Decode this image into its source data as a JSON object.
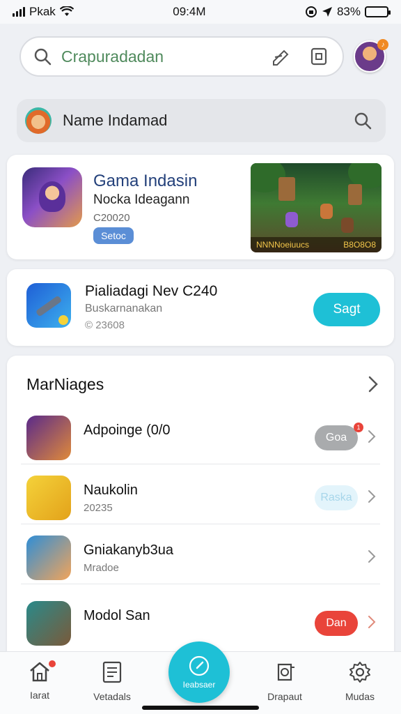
{
  "status_bar": {
    "carrier": "Pkak",
    "time": "09:4M",
    "battery": "83%",
    "battery_level": 0.83
  },
  "search": {
    "placeholder": "Crapuradadan"
  },
  "name_search": {
    "text": "Name Indamad"
  },
  "featured": {
    "title": "Gama Indasin",
    "subtitle": "Nocka Ideagann",
    "meta": "C20020",
    "badge": "Setoc",
    "hud_left": "NNNNoeiuucs",
    "hud_right": "B8O8O8"
  },
  "promo": {
    "title": "Pialiadagi Nev C240",
    "subtitle": "Buskarnanakan",
    "meta": "© 23608",
    "button": "Sagt"
  },
  "list": {
    "heading": "MarNiages",
    "rows": [
      {
        "title": "Adpoinge (0/0",
        "subtitle": "",
        "button": "Goa",
        "button_style": "gray",
        "has_badge": true,
        "badge_text": "1"
      },
      {
        "title": "Naukolin",
        "subtitle": "20235",
        "button": "Raska",
        "button_style": "light",
        "has_badge": false
      },
      {
        "title": "Gniakanyb3ua",
        "subtitle": "Mradoe",
        "button": "",
        "button_style": "none",
        "has_badge": false
      },
      {
        "title": "Modol San",
        "subtitle": "",
        "button": "Dan",
        "button_style": "red",
        "has_badge": false
      }
    ]
  },
  "bottom_nav": {
    "items": [
      {
        "label": "Iarat",
        "icon": "home-icon",
        "has_dot": true
      },
      {
        "label": "Vetadals",
        "icon": "list-icon",
        "has_dot": false
      },
      {
        "label": "Ieabsaer",
        "icon": "compass-icon",
        "is_fab": true
      },
      {
        "label": "Drapaut",
        "icon": "download-icon",
        "has_dot": false
      },
      {
        "label": "Mudas",
        "icon": "gear-icon",
        "has_dot": false
      }
    ]
  },
  "colors": {
    "accent": "#1ec0d6",
    "red": "#e9443a",
    "badge_blue": "#5b8ed6",
    "title_blue": "#23407a"
  }
}
